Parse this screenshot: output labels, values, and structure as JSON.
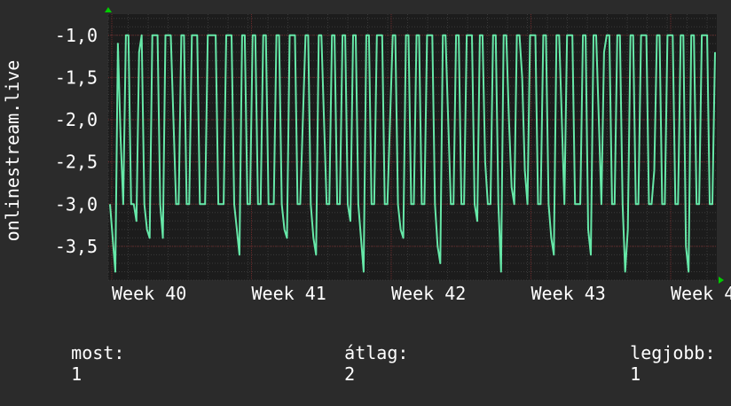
{
  "colors": {
    "background": "#2b2b2b",
    "plot_background": "#1c1c1c",
    "grid_major": "#6a2a2a",
    "grid_minor": "#3a3a3a",
    "line": "#66e8a8",
    "axis_arrow": "#00cc00",
    "text": "#ffffff"
  },
  "footer": {
    "now_label": "most:",
    "now_value": "1",
    "avg_label": "átlag:",
    "avg_value": "2",
    "best_label": "legjobb:",
    "best_value": "1"
  },
  "chart_data": {
    "type": "line",
    "title": "",
    "xlabel": "",
    "ylabel": "onlinestream.live",
    "ylim": [
      -3.9,
      -0.75
    ],
    "y_ticks": [
      -1.0,
      -1.5,
      -2.0,
      -2.5,
      -3.0,
      -3.5
    ],
    "y_tick_labels": [
      "-1,0",
      "-1,5",
      "-2,0",
      "-2,5",
      "-3,0",
      "-3,5"
    ],
    "x_tick_labels": [
      "Week 40",
      "Week 41",
      "Week 42",
      "Week 43",
      "Week 4"
    ],
    "grid": true,
    "series": [
      {
        "values": [
          -3.0,
          -3.4,
          -3.8,
          -1.1,
          -2.2,
          -3.0,
          -1.0,
          -1.0,
          -3.0,
          -3.0,
          -3.2,
          -1.2,
          -1.0,
          -3.0,
          -3.3,
          -3.4,
          -1.0,
          -1.0,
          -1.0,
          -3.0,
          -3.4,
          -1.0,
          -1.0,
          -1.0,
          -2.0,
          -3.0,
          -3.0,
          -1.0,
          -1.0,
          -3.0,
          -3.0,
          -1.0,
          -1.0,
          -1.0,
          -3.0,
          -3.0,
          -3.0,
          -1.0,
          -1.0,
          -1.0,
          -1.0,
          -3.0,
          -3.0,
          -3.0,
          -1.0,
          -1.0,
          -1.0,
          -3.0,
          -3.3,
          -3.6,
          -1.0,
          -1.0,
          -3.0,
          -3.0,
          -1.0,
          -1.0,
          -3.0,
          -3.0,
          -1.0,
          -1.0,
          -3.0,
          -3.0,
          -3.0,
          -1.0,
          -1.0,
          -3.0,
          -3.3,
          -3.4,
          -1.0,
          -1.0,
          -1.0,
          -3.0,
          -3.0,
          -2.0,
          -1.0,
          -1.0,
          -3.0,
          -3.4,
          -3.6,
          -1.0,
          -1.0,
          -2.0,
          -3.0,
          -3.0,
          -1.0,
          -1.0,
          -3.0,
          -3.0,
          -1.0,
          -1.0,
          -3.0,
          -3.2,
          -1.0,
          -1.0,
          -3.0,
          -3.4,
          -3.8,
          -1.0,
          -1.0,
          -3.0,
          -3.0,
          -1.0,
          -1.0,
          -1.0,
          -3.0,
          -3.0,
          -2.0,
          -1.0,
          -1.0,
          -3.0,
          -3.3,
          -3.4,
          -1.0,
          -1.0,
          -3.0,
          -3.0,
          -1.0,
          -1.0,
          -3.0,
          -3.0,
          -1.0,
          -1.0,
          -1.0,
          -3.0,
          -3.5,
          -3.7,
          -1.0,
          -1.0,
          -2.0,
          -3.0,
          -3.0,
          -1.0,
          -1.0,
          -3.0,
          -3.0,
          -1.0,
          -1.0,
          -1.0,
          -3.0,
          -3.2,
          -1.0,
          -1.0,
          -2.5,
          -3.0,
          -3.0,
          -1.0,
          -1.0,
          -3.0,
          -3.8,
          -1.0,
          -1.0,
          -2.0,
          -2.8,
          -3.0,
          -1.0,
          -1.0,
          -1.5,
          -2.6,
          -3.0,
          -1.0,
          -1.0,
          -1.0,
          -3.0,
          -3.0,
          -1.0,
          -1.0,
          -3.0,
          -3.4,
          -3.6,
          -1.0,
          -1.0,
          -2.0,
          -3.0,
          -1.0,
          -1.0,
          -1.0,
          -3.0,
          -3.0,
          -3.0,
          -1.0,
          -1.0,
          -3.3,
          -3.6,
          -1.0,
          -1.0,
          -2.0,
          -3.0,
          -1.2,
          -1.0,
          -1.0,
          -3.0,
          -3.0,
          -1.0,
          -1.0,
          -3.0,
          -3.8,
          -3.3,
          -1.0,
          -1.0,
          -3.0,
          -3.0,
          -1.0,
          -1.0,
          -1.0,
          -3.0,
          -3.0,
          -2.6,
          -1.0,
          -1.0,
          -3.0,
          -3.0,
          -1.0,
          -1.0,
          -1.0,
          -3.0,
          -3.0,
          -1.0,
          -1.0,
          -3.5,
          -3.8,
          -1.0,
          -1.0,
          -3.0,
          -3.0,
          -1.0,
          -1.0,
          -1.0,
          -3.0,
          -3.0,
          -1.2
        ]
      }
    ]
  }
}
